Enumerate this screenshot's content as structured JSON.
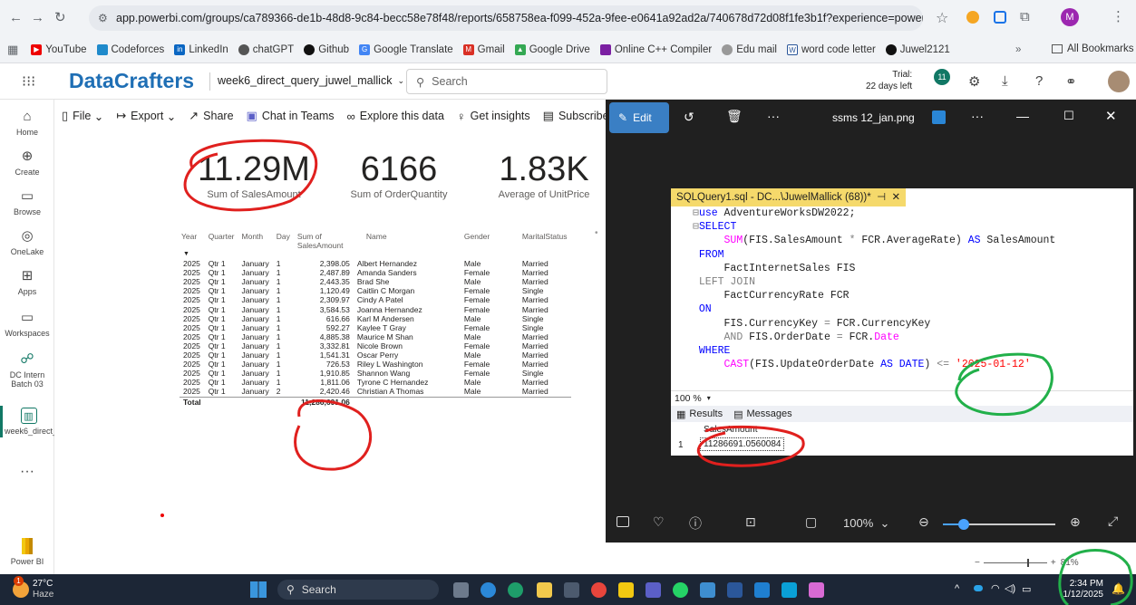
{
  "browser": {
    "url": "app.powerbi.com/groups/ca789366-de1b-48d8-9c84-becc58e78f48/reports/658758ea-f099-452a-9fee-e0641a92ad2a/740678d72d08f1fe3b1f?experience=power-bi",
    "profile_initial": "M",
    "bookmarks": [
      "YouTube",
      "Codeforces",
      "LinkedIn",
      "chatGPT",
      "Github",
      "Google Translate",
      "Gmail",
      "Google Drive",
      "Online C++ Compiler",
      "Edu mail",
      "word code letter",
      "Juwel2121"
    ],
    "all_bookmarks": "All Bookmarks"
  },
  "powerbi": {
    "brand": "DataCrafters",
    "report_name": "week6_direct_query_juwel_mallick",
    "search_placeholder": "Search",
    "trial_line1": "Trial:",
    "trial_line2": "22 days left",
    "notif_count": "11",
    "rail": [
      {
        "label": "Home",
        "icon": "home-icon"
      },
      {
        "label": "Create",
        "icon": "plus-icon"
      },
      {
        "label": "Browse",
        "icon": "folder-icon"
      },
      {
        "label": "OneLake",
        "icon": "onelake-icon"
      },
      {
        "label": "Apps",
        "icon": "apps-icon"
      },
      {
        "label": "Workspaces",
        "icon": "workspaces-icon"
      },
      {
        "label": "DC Intern Batch 03",
        "icon": "group-icon"
      },
      {
        "label": "week6_direct_query_ju...",
        "icon": "report-icon"
      }
    ],
    "power_bi_label": "Power BI",
    "ribbon": [
      "File",
      "Export",
      "Share",
      "Chat in Teams",
      "Explore this data",
      "Get insights",
      "Subscribe to"
    ],
    "zoom": "81%"
  },
  "report": {
    "kpis": [
      {
        "value": "11.29M",
        "label": "Sum of SalesAmount"
      },
      {
        "value": "6166",
        "label": "Sum of OrderQuantity"
      },
      {
        "value": "1.83K",
        "label": "Average of UnitPrice"
      }
    ],
    "table": {
      "headers": [
        "Year",
        "Quarter",
        "Month",
        "Day",
        "Sum of SalesAmount",
        "Name",
        "Gender",
        "MaritalStatus"
      ],
      "rows": [
        [
          "2025",
          "Qtr 1",
          "January",
          "1",
          "2,398.05",
          "Albert Hernandez",
          "Male",
          "Married"
        ],
        [
          "2025",
          "Qtr 1",
          "January",
          "1",
          "2,487.89",
          "Amanda Sanders",
          "Female",
          "Married"
        ],
        [
          "2025",
          "Qtr 1",
          "January",
          "1",
          "2,443.35",
          "Brad She",
          "Male",
          "Married"
        ],
        [
          "2025",
          "Qtr 1",
          "January",
          "1",
          "1,120.49",
          "Caitlin C Morgan",
          "Female",
          "Single"
        ],
        [
          "2025",
          "Qtr 1",
          "January",
          "1",
          "2,309.97",
          "Cindy A Patel",
          "Female",
          "Married"
        ],
        [
          "2025",
          "Qtr 1",
          "January",
          "1",
          "3,584.53",
          "Joanna Hernandez",
          "Female",
          "Married"
        ],
        [
          "2025",
          "Qtr 1",
          "January",
          "1",
          "616.66",
          "Karl M Andersen",
          "Male",
          "Single"
        ],
        [
          "2025",
          "Qtr 1",
          "January",
          "1",
          "592.27",
          "Kaylee T Gray",
          "Female",
          "Single"
        ],
        [
          "2025",
          "Qtr 1",
          "January",
          "1",
          "4,885.38",
          "Maurice M Shan",
          "Male",
          "Married"
        ],
        [
          "2025",
          "Qtr 1",
          "January",
          "1",
          "3,332.81",
          "Nicole Brown",
          "Female",
          "Married"
        ],
        [
          "2025",
          "Qtr 1",
          "January",
          "1",
          "1,541.31",
          "Oscar Perry",
          "Male",
          "Married"
        ],
        [
          "2025",
          "Qtr 1",
          "January",
          "1",
          "726.53",
          "Riley L Washington",
          "Female",
          "Married"
        ],
        [
          "2025",
          "Qtr 1",
          "January",
          "1",
          "1,910.85",
          "Shannon Wang",
          "Female",
          "Single"
        ],
        [
          "2025",
          "Qtr 1",
          "January",
          "1",
          "1,811.06",
          "Tyrone C Hernandez",
          "Male",
          "Married"
        ],
        [
          "2025",
          "Qtr 1",
          "January",
          "2",
          "2,420.46",
          "Christian A Thomas",
          "Male",
          "Married"
        ]
      ],
      "total_label": "Total",
      "total_value": "11,286,691.06"
    }
  },
  "viewer": {
    "edit": "Edit",
    "filename": "ssms 12_jan.png",
    "zoom": "100%",
    "sql_tab": "SQLQuery1.sql - DC...\\JuwelMallick (68))*",
    "code_zoom": "100 %",
    "results_tab": "Results",
    "messages_tab": "Messages",
    "result_col": "SalesAmount",
    "result_row_num": "1",
    "result_value": "11286691.0560084"
  },
  "taskbar": {
    "temp": "27°C",
    "weather": "Haze",
    "weather_badge": "1",
    "search": "Search",
    "time": "2:34 PM",
    "date": "1/12/2025"
  }
}
